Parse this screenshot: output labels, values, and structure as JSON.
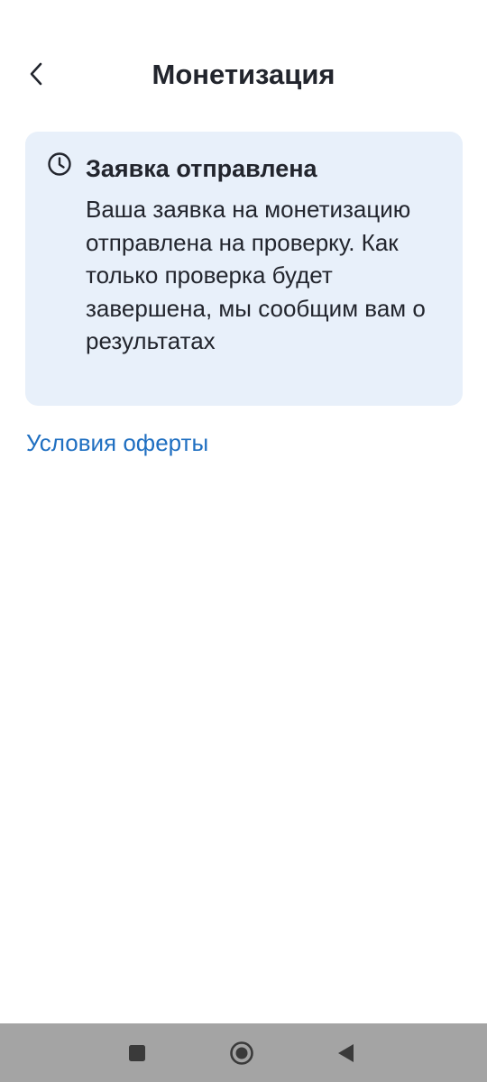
{
  "header": {
    "title": "Монетизация",
    "back_icon": "chevron-left-icon"
  },
  "status_card": {
    "icon": "clock-icon",
    "title": "Заявка отправлена",
    "description": "Ваша заявка на монетизацию отправлена на проверку. Как только проверка будет завершена, мы сообщим вам о результатах",
    "background_color": "#e8f0fa"
  },
  "offer_link": {
    "label": "Условия оферты",
    "color": "#1f6fc1"
  },
  "system_nav": {
    "background_color": "#a4a4a4",
    "buttons": [
      "recents-icon",
      "home-icon",
      "back-triangle-icon"
    ]
  }
}
